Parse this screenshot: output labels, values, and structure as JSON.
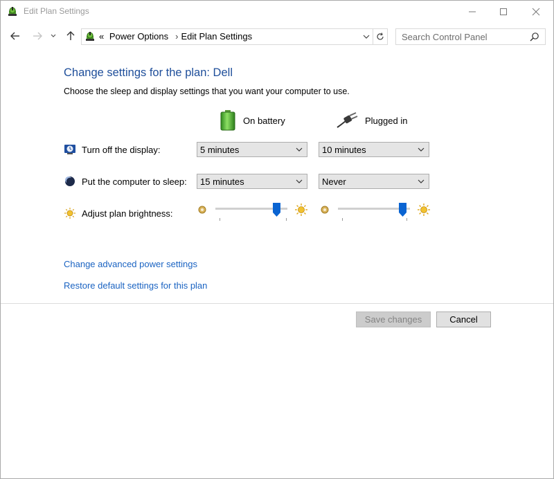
{
  "window": {
    "title": "Edit Plan Settings"
  },
  "nav": {
    "breadcrumbs": [
      "Power Options",
      "Edit Plan Settings"
    ],
    "overflow": "«",
    "search_placeholder": "Search Control Panel"
  },
  "main": {
    "heading": "Change settings for the plan: Dell",
    "subtext": "Choose the sleep and display settings that you want your computer to use.",
    "columns": {
      "battery": "On battery",
      "plugged": "Plugged in"
    },
    "rows": {
      "display": {
        "label": "Turn off the display:",
        "battery": "5 minutes",
        "plugged": "10 minutes"
      },
      "sleep": {
        "label": "Put the computer to sleep:",
        "battery": "15 minutes",
        "plugged": "Never"
      },
      "brightness": {
        "label": "Adjust plan brightness:",
        "battery_level": 0.85,
        "plugged_level": 1.0
      }
    },
    "links": {
      "advanced": "Change advanced power settings",
      "restore": "Restore default settings for this plan"
    }
  },
  "footer": {
    "save": "Save changes",
    "cancel": "Cancel"
  },
  "colors": {
    "heading": "#1e4e9a",
    "link": "#1a63c2",
    "slider_thumb": "#0a64d2"
  },
  "icons": [
    "power-options-icon",
    "minimize-icon",
    "maximize-icon",
    "close-icon",
    "back-arrow-icon",
    "forward-arrow-icon",
    "recent-dropdown-icon",
    "up-arrow-icon",
    "refresh-icon",
    "search-icon",
    "battery-icon",
    "plug-icon",
    "monitor-icon",
    "sleep-moon-icon",
    "brightness-sun-icon"
  ]
}
